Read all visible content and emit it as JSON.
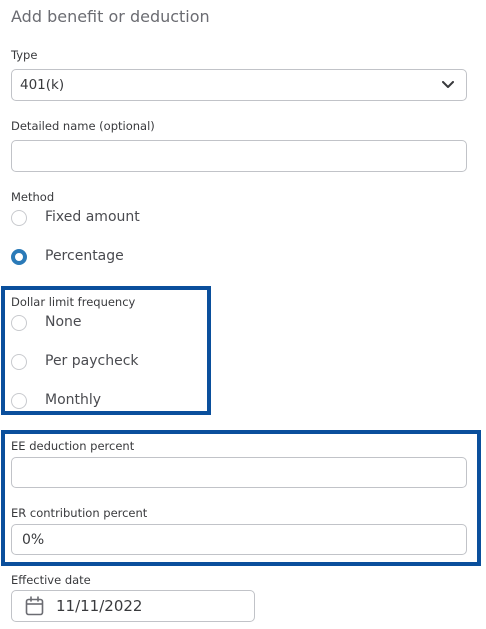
{
  "dialog": {
    "title": "Add benefit or deduction"
  },
  "type_field": {
    "label": "Type",
    "selected": "401(k)"
  },
  "detailed_name": {
    "label": "Detailed name (optional)",
    "value": ""
  },
  "method": {
    "label": "Method",
    "options": [
      {
        "label": "Fixed amount",
        "checked": false
      },
      {
        "label": "Percentage",
        "checked": true
      }
    ]
  },
  "dollar_limit_frequency": {
    "label": "Dollar limit frequency",
    "options": [
      {
        "label": "None",
        "checked": false
      },
      {
        "label": "Per paycheck",
        "checked": false
      },
      {
        "label": "Monthly",
        "checked": false
      }
    ]
  },
  "ee_deduction_percent": {
    "label": "EE deduction percent",
    "value": ""
  },
  "er_contribution_percent": {
    "label": "ER contribution percent",
    "value": "0%"
  },
  "effective_date": {
    "label": "Effective date",
    "value": "11/11/2022"
  },
  "colors": {
    "highlight_border": "#0a4f9c",
    "radio_checked": "#2a7ab8",
    "field_border": "#c1c3c8",
    "text": "#393a3d"
  },
  "icons": {
    "type_dropdown": "chevron-down-icon",
    "date_picker": "calendar-icon"
  }
}
